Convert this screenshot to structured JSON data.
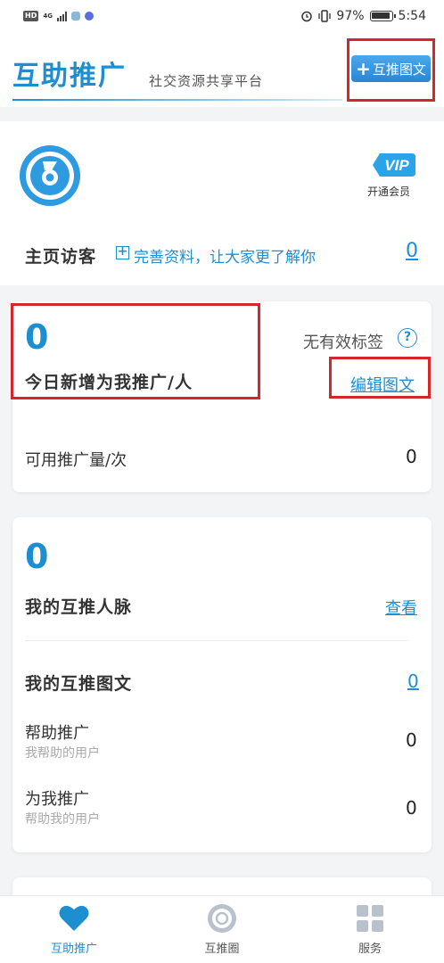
{
  "status_bar": {
    "network_badge": "HD",
    "network_type": "4G",
    "battery": "97%",
    "time": "5:54"
  },
  "header": {
    "title": "互助推广",
    "subtitle": "社交资源共享平台",
    "post_button_label": "互推图文"
  },
  "profile": {
    "vip_badge": "VIP",
    "vip_label": "开通会员",
    "visitors_title": "主页访客",
    "complete_profile_hint": "完善资料，让大家更了解你",
    "visitors_count": "0"
  },
  "promo_card": {
    "today_new_count": "0",
    "today_new_label": "今日新增为我推广/人",
    "no_valid_tags": "无有效标签",
    "help_icon": "?",
    "edit_link": "编辑图文",
    "available_label": "可用推广量/次",
    "available_value": "0"
  },
  "network_card": {
    "contacts_count": "0",
    "contacts_label": "我的互推人脉",
    "view_link": "查看",
    "my_posts_label": "我的互推图文",
    "my_posts_count": "0",
    "help_promote_label": "帮助推广",
    "help_promote_sub": "我帮助的用户",
    "help_promote_value": "0",
    "promote_me_label": "为我推广",
    "promote_me_sub": "帮助我的用户",
    "promote_me_value": "0"
  },
  "bottom_nav": {
    "items": [
      {
        "label": "互助推广",
        "icon": "heart-icon",
        "active": true
      },
      {
        "label": "互推圈",
        "icon": "circle-icon",
        "active": false
      },
      {
        "label": "服务",
        "icon": "grid-icon",
        "active": false
      }
    ]
  },
  "colors": {
    "accent": "#1d8fd1",
    "highlight_box": "#d6262b",
    "background": "#f3f4f6"
  }
}
